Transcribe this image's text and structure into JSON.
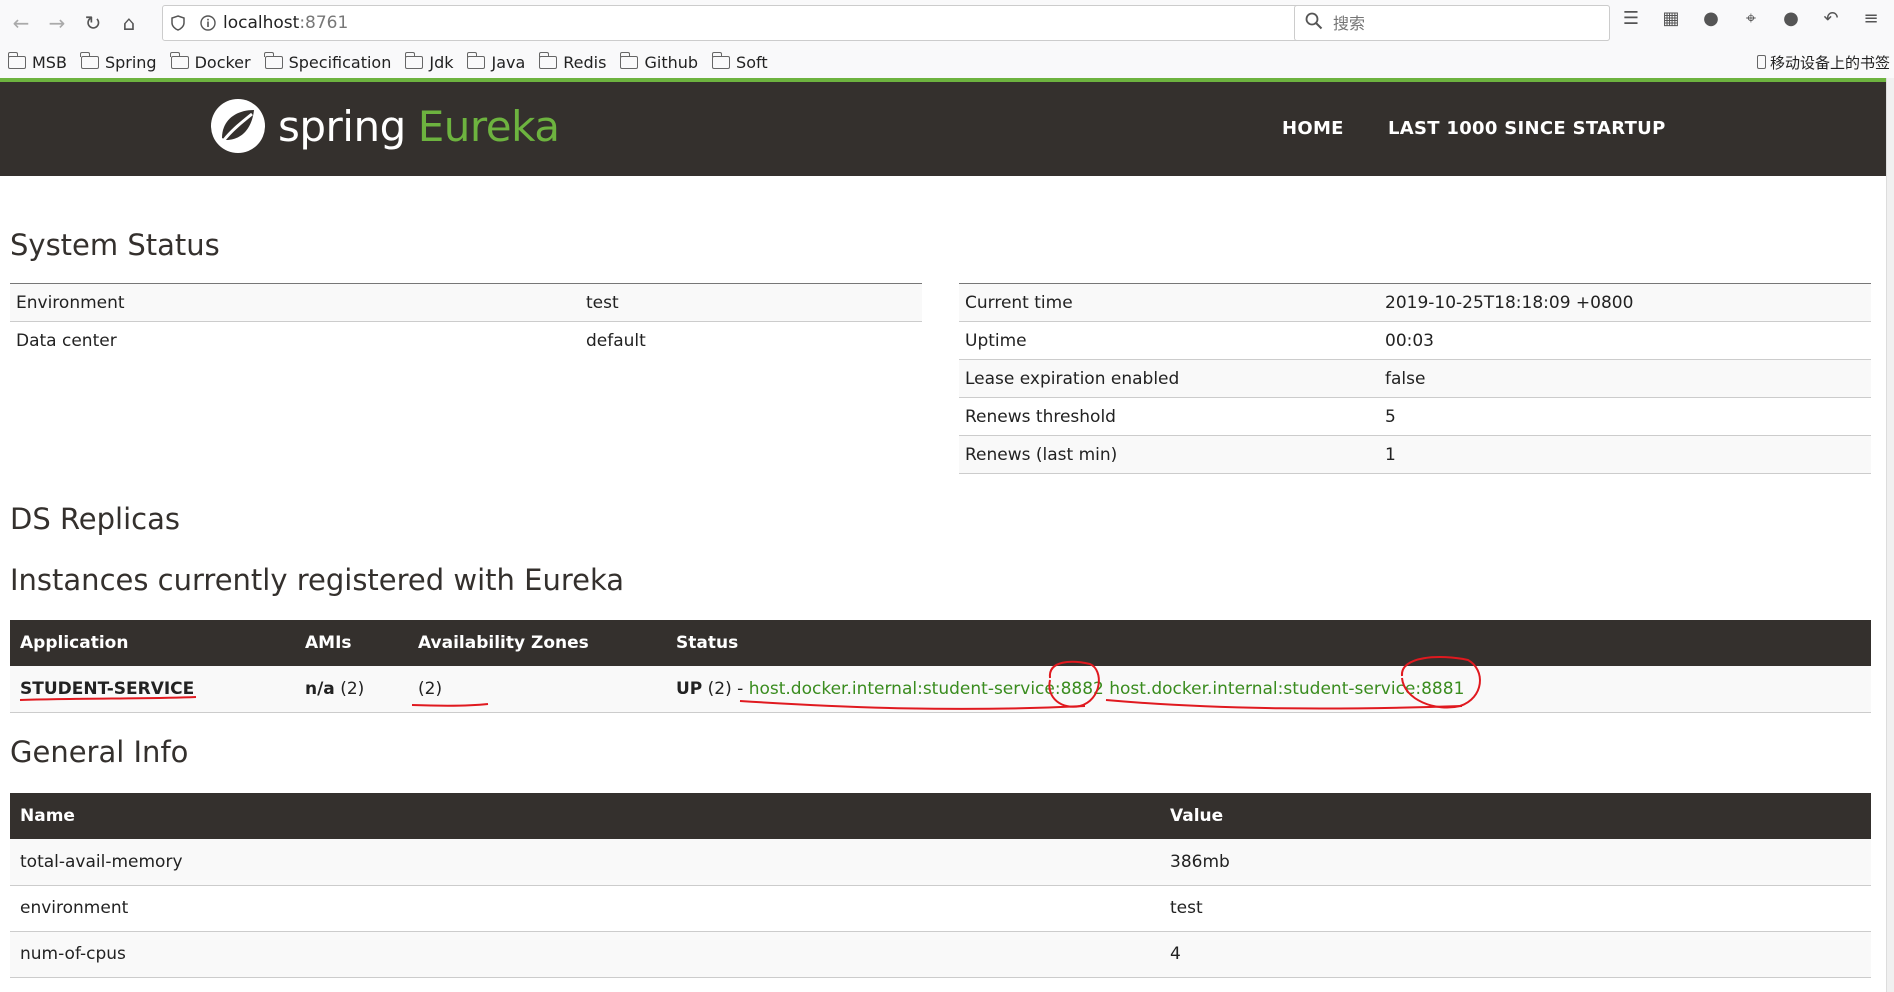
{
  "browser": {
    "url_host": "localhost",
    "url_port": ":8761",
    "search_placeholder": "搜索",
    "bookmarks": [
      "MSB",
      "Spring",
      "Docker",
      "Specification",
      "Jdk",
      "Java",
      "Redis",
      "Github",
      "Soft"
    ],
    "mobile_bookmarks": "移动设备上的书签"
  },
  "header": {
    "logo_spring": "spring",
    "logo_eureka": "Eureka",
    "nav_home": "HOME",
    "nav_last": "LAST 1000 SINCE STARTUP"
  },
  "system_status": {
    "title": "System Status",
    "left": [
      {
        "label": "Environment",
        "value": "test"
      },
      {
        "label": "Data center",
        "value": "default"
      }
    ],
    "right": [
      {
        "label": "Current time",
        "value": "2019-10-25T18:18:09 +0800"
      },
      {
        "label": "Uptime",
        "value": "00:03"
      },
      {
        "label": "Lease expiration enabled",
        "value": "false"
      },
      {
        "label": "Renews threshold",
        "value": "5"
      },
      {
        "label": "Renews (last min)",
        "value": "1"
      }
    ]
  },
  "ds_replicas": {
    "title": "DS Replicas"
  },
  "instances": {
    "title": "Instances currently registered with Eureka",
    "headers": [
      "Application",
      "AMIs",
      "Availability Zones",
      "Status"
    ],
    "rows": [
      {
        "application": "STUDENT-SERVICE",
        "amis_bold": "n/a",
        "amis_count": "(2)",
        "zones": "(2)",
        "status_bold": "UP",
        "status_count": "(2) -",
        "link1": "host.docker.internal:student-service:8882",
        "link2": "host.docker.internal:student-service:8881"
      }
    ]
  },
  "general_info": {
    "title": "General Info",
    "headers": [
      "Name",
      "Value"
    ],
    "rows": [
      {
        "name": "total-avail-memory",
        "value": "386mb"
      },
      {
        "name": "environment",
        "value": "test"
      },
      {
        "name": "num-of-cpus",
        "value": "4"
      }
    ]
  },
  "colors": {
    "header_bg": "#34302d",
    "spring_green": "#6db33f",
    "link_green": "#3a8c1f",
    "annotation_red": "#e0191f"
  }
}
